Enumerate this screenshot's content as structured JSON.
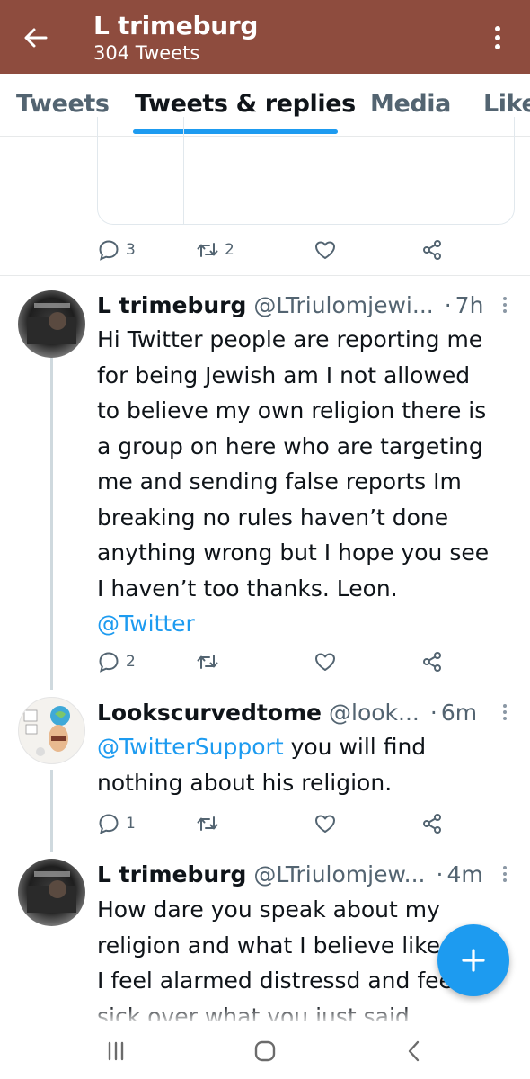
{
  "header": {
    "back_icon": "arrow-left-icon",
    "title": "L trimeburg",
    "subtitle": "304 Tweets",
    "more_icon": "more-vertical-icon",
    "background": "#8e4c3e"
  },
  "tabs": [
    {
      "label": "Tweets",
      "active": false
    },
    {
      "label": "Tweets & replies",
      "active": true
    },
    {
      "label": "Media",
      "active": false
    },
    {
      "label": "Likes",
      "active": false
    }
  ],
  "previous_tweet": {
    "reply_count": "3",
    "retweet_count": "2",
    "like_count": "",
    "share_icon": "share-icon"
  },
  "tweets": [
    {
      "name": "L trimeburg",
      "handle": "@LTriulomjewi...",
      "time": "7h",
      "lines": [
        "Hi Twitter people are reporting me",
        "for being Jewish am I not allowed",
        "to believe my own religion there is",
        "a group on here who are targeting",
        "me and sending false reports Im",
        "breaking no rules haven’t done",
        "anything wrong but I hope you see",
        "I haven’t too thanks. Leon."
      ],
      "mention": "@Twitter",
      "reply_count": "2",
      "retweet_count": "",
      "like_count": ""
    },
    {
      "name": "Lookscurvedtome",
      "handle": "@look...",
      "time": "6m",
      "mention": "@TwitterSupport",
      "line1_rest": "you will find",
      "line2": "nothing about his religion.",
      "reply_count": "1",
      "retweet_count": "",
      "like_count": ""
    },
    {
      "name": "L trimeburg",
      "handle": "@LTriulomjew...",
      "time": "4m",
      "lines": [
        "How dare you speak about my",
        "religion and what I believe like",
        "I feel alarmed distressd and feel",
        "sick over what you just said"
      ]
    }
  ],
  "fab": {
    "icon": "plus-icon",
    "color": "#1d9bf0"
  },
  "system_nav": {
    "recents_icon": "recents-icon",
    "home_icon": "home-icon",
    "back_icon": "back-icon"
  }
}
